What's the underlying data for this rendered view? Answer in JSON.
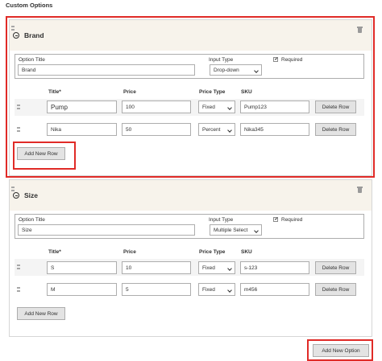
{
  "page": {
    "heading": "Custom Options"
  },
  "labels": {
    "option_title": "Option Title",
    "input_type": "Input Type",
    "required": "Required",
    "col_title": "Title*",
    "col_price": "Price",
    "col_price_type": "Price Type",
    "col_sku": "SKU",
    "delete_row": "Delete Row",
    "add_new_row": "Add New Row",
    "add_new_option": "Add New Option"
  },
  "options": [
    {
      "name": "Brand",
      "title": "Brand",
      "input_type": "Drop-down",
      "required": true,
      "rows": [
        {
          "title": "Pump",
          "price": "100",
          "price_type": "Fixed",
          "sku": "Pump123"
        },
        {
          "title": "Nika",
          "price": "50",
          "price_type": "Percent",
          "sku": "Nika345"
        }
      ]
    },
    {
      "name": "Size",
      "title": "Size",
      "input_type": "Multiple Select",
      "required": true,
      "rows": [
        {
          "title": "S",
          "price": "10",
          "price_type": "Fixed",
          "sku": "s-123"
        },
        {
          "title": "M",
          "price": "5",
          "price_type": "Fixed",
          "sku": "m456"
        }
      ]
    }
  ],
  "colors": {
    "highlight": "#e02b27",
    "header_bg": "#f7f3eb",
    "button_bg": "#e3e3e3"
  },
  "icons": {
    "collapse": "minus-circle-icon",
    "delete": "trash-icon",
    "drag": "drag-handle-icon",
    "check": "checkmark-icon"
  }
}
